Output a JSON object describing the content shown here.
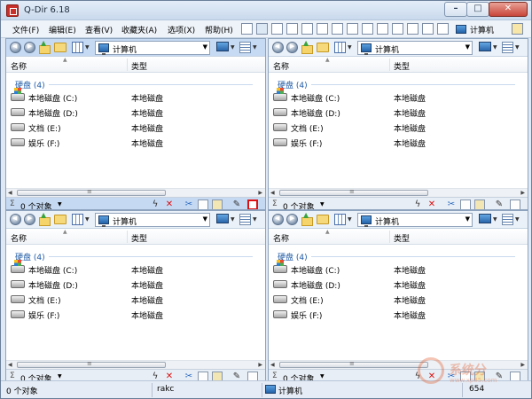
{
  "app": {
    "title": "Q-Dir 6.18"
  },
  "window_buttons": {
    "minimize": "–",
    "maximize": "□",
    "close": "✕"
  },
  "menu": {
    "items": [
      "文件(F)",
      "编辑(E)",
      "查看(V)",
      "收藏夹(A)",
      "选项(X)",
      "帮助(H)"
    ],
    "computer_label": "计算机"
  },
  "panes": [
    {
      "active": true,
      "address": "计算机",
      "columns": {
        "name": "名称",
        "type": "类型"
      },
      "group": "硬盘 (4)",
      "drives": [
        {
          "name": "本地磁盘 (C:)",
          "type": "本地磁盘",
          "system": true
        },
        {
          "name": "本地磁盘 (D:)",
          "type": "本地磁盘",
          "system": false
        },
        {
          "name": "文档 (E:)",
          "type": "本地磁盘",
          "system": false
        },
        {
          "name": "娱乐 (F:)",
          "type": "本地磁盘",
          "system": false
        }
      ],
      "status": {
        "sigma": "Σ",
        "count": "0 个对象"
      }
    },
    {
      "active": false,
      "address": "计算机",
      "columns": {
        "name": "名称",
        "type": "类型"
      },
      "group": "硬盘 (4)",
      "drives": [
        {
          "name": "本地磁盘 (C:)",
          "type": "本地磁盘",
          "system": true
        },
        {
          "name": "本地磁盘 (D:)",
          "type": "本地磁盘",
          "system": false
        },
        {
          "name": "文档 (E:)",
          "type": "本地磁盘",
          "system": false
        },
        {
          "name": "娱乐 (F:)",
          "type": "本地磁盘",
          "system": false
        }
      ],
      "status": {
        "sigma": "Σ",
        "count": "0 个对象"
      }
    },
    {
      "active": false,
      "address": "计算机",
      "columns": {
        "name": "名称",
        "type": "类型"
      },
      "group": "硬盘 (4)",
      "drives": [
        {
          "name": "本地磁盘 (C:)",
          "type": "本地磁盘",
          "system": true
        },
        {
          "name": "本地磁盘 (D:)",
          "type": "本地磁盘",
          "system": false
        },
        {
          "name": "文档 (E:)",
          "type": "本地磁盘",
          "system": false
        },
        {
          "name": "娱乐 (F:)",
          "type": "本地磁盘",
          "system": false
        }
      ],
      "status": {
        "sigma": "Σ",
        "count": "0 个对象"
      }
    },
    {
      "active": false,
      "address": "计算机",
      "columns": {
        "name": "名称",
        "type": "类型"
      },
      "group": "硬盘 (4)",
      "drives": [
        {
          "name": "本地磁盘 (C:)",
          "type": "本地磁盘",
          "system": true
        },
        {
          "name": "本地磁盘 (D:)",
          "type": "本地磁盘",
          "system": false
        },
        {
          "name": "文档 (E:)",
          "type": "本地磁盘",
          "system": false
        },
        {
          "name": "娱乐 (F:)",
          "type": "本地磁盘",
          "system": false
        }
      ],
      "status": {
        "sigma": "Σ",
        "count": "0 个对象"
      }
    }
  ],
  "bottom_status": {
    "objects": "0 个对象",
    "user": "rakc",
    "location": "计算机",
    "number": "654"
  },
  "watermark": {
    "text": "系统分",
    "url": "www.xp85.com"
  },
  "colors": {
    "accent": "#c6daf3",
    "group_text": "#1e5aa6",
    "close_red": "#c8453a"
  }
}
